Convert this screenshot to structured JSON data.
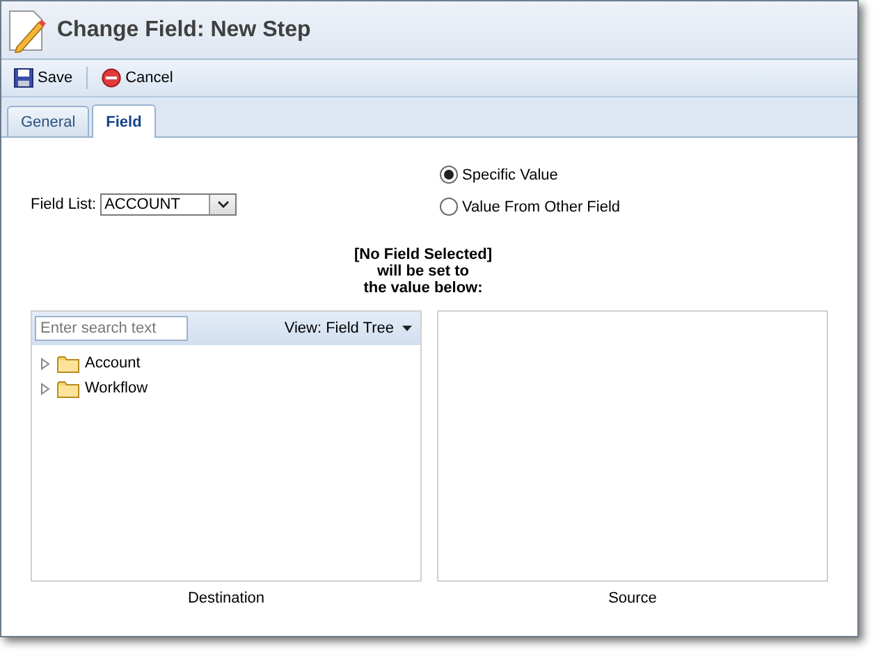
{
  "window": {
    "title": "Change Field: New Step"
  },
  "toolbar": [
    {
      "kind": "save",
      "label": "Save"
    },
    {
      "kind": "cancel",
      "label": "Cancel"
    }
  ],
  "tabs": [
    {
      "label": "General",
      "selected": false
    },
    {
      "label": "Field",
      "selected": true
    }
  ],
  "field_list": {
    "label": "Field List:",
    "value": "ACCOUNT"
  },
  "value_source": [
    {
      "label": "Specific Value",
      "selected": true
    },
    {
      "label": "Value From Other Field",
      "selected": false
    }
  ],
  "caption": [
    "[No Field Selected]",
    "will be set to",
    "the value below:"
  ],
  "destination": {
    "search": {
      "placeholder": "Enter search text"
    },
    "view": "View: Field Tree",
    "label": "Destination",
    "tree": [
      {
        "label": "Account",
        "expanded": false
      },
      {
        "label": "Workflow",
        "expanded": false
      }
    ]
  },
  "source": {
    "label": "Source"
  }
}
